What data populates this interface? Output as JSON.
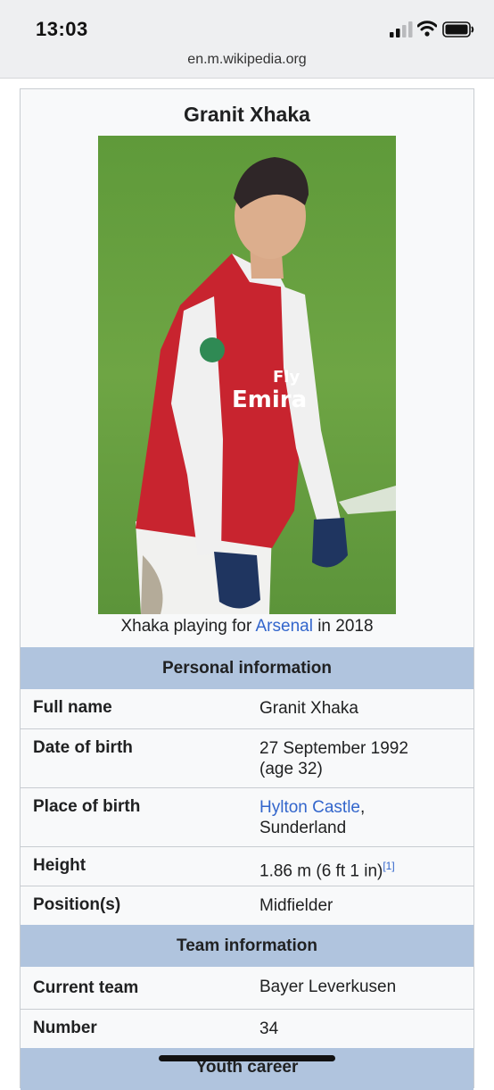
{
  "status_bar": {
    "time": "13:03",
    "url": "en.m.wikipedia.org",
    "icons": [
      "signal-icon",
      "wifi-icon",
      "battery-icon"
    ]
  },
  "infobox": {
    "title": "Granit Xhaka",
    "image": {
      "caption_prefix": "Xhaka playing for ",
      "caption_link": "Arsenal",
      "caption_suffix": " in 2018"
    },
    "personal_header": "Personal information",
    "full_name": {
      "label": "Full name",
      "value": "Granit Xhaka"
    },
    "date_of_birth": {
      "label": "Date of birth",
      "value_line1": "27 September 1992",
      "value_line2": "(age 32)"
    },
    "place_of_birth": {
      "label": "Place of birth",
      "link": "Hylton Castle",
      "suffix": ",",
      "line2": "Sunderland"
    },
    "height": {
      "label": "Height",
      "value": "1.86 m (6 ft 1 in)",
      "ref": "[1]"
    },
    "positions": {
      "label": "Position(s)",
      "value": "Midfielder"
    },
    "team_header": "Team information",
    "current_team": {
      "label": "Current team",
      "value": "Bayer Leverkusen"
    },
    "number": {
      "label": "Number",
      "value": "34"
    },
    "youth_header": "Youth career"
  },
  "colors": {
    "link": "#3366cc",
    "section_header": "#b0c4de",
    "infobox_bg": "#f8f9fa",
    "border": "#c8ccd1"
  }
}
